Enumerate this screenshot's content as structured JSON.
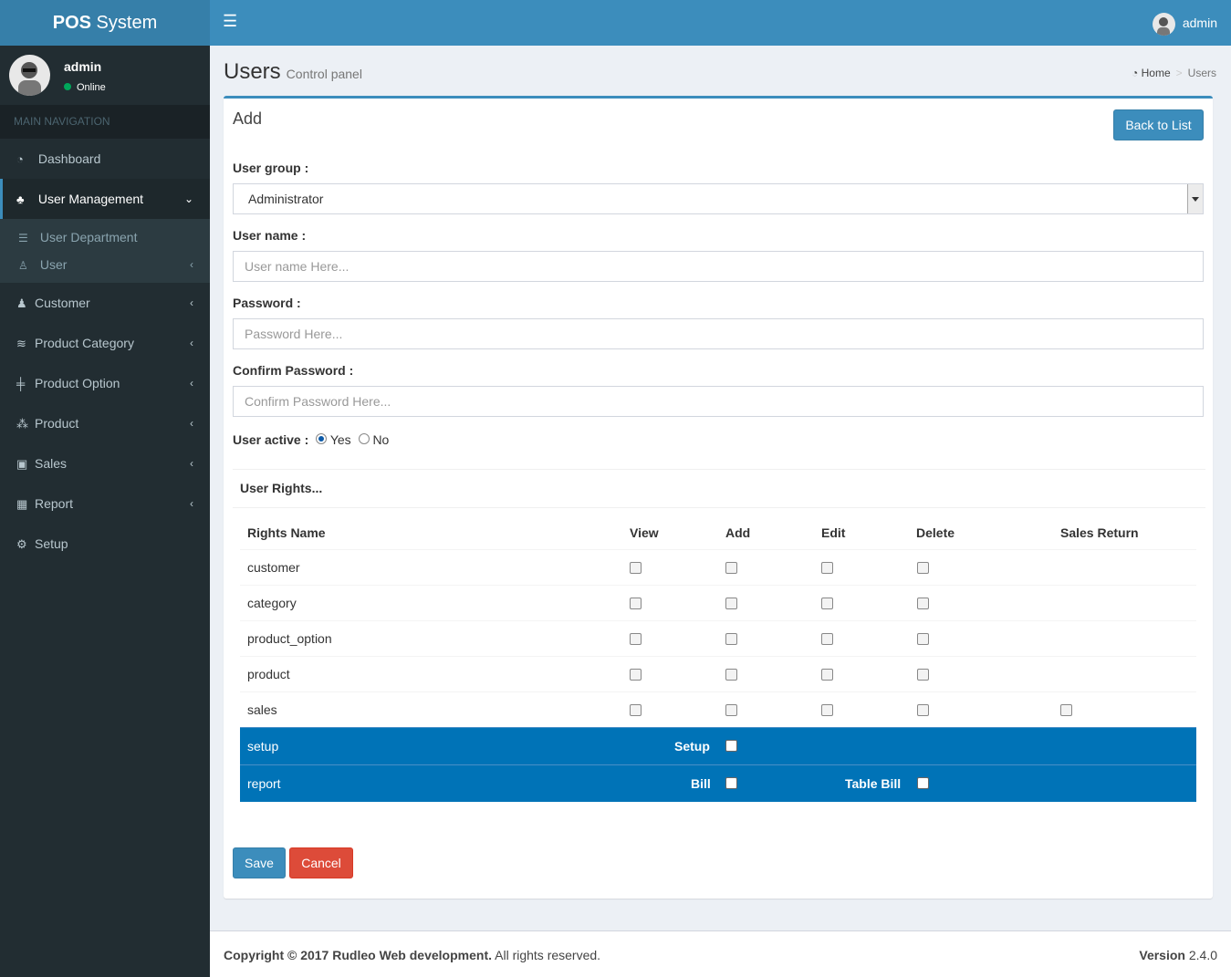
{
  "app": {
    "title_bold": "POS",
    "title_rest": " System"
  },
  "user": {
    "name": "admin",
    "status": "Online"
  },
  "nav": {
    "header": "MAIN NAVIGATION",
    "items": [
      {
        "label": "Dashboard",
        "icon": "dashboard-icon"
      },
      {
        "label": "User Management",
        "icon": "sitemap-icon"
      },
      {
        "label": "Customer",
        "icon": "user-icon"
      },
      {
        "label": "Product Category",
        "icon": "database-icon"
      },
      {
        "label": "Product Option",
        "icon": "signs-icon"
      },
      {
        "label": "Product",
        "icon": "cubes-icon"
      },
      {
        "label": "Sales",
        "icon": "calendar-check-icon"
      },
      {
        "label": "Report",
        "icon": "table-icon"
      },
      {
        "label": "Setup",
        "icon": "gear-icon"
      }
    ],
    "sub_items": [
      {
        "label": "User Department",
        "icon": "list-icon"
      },
      {
        "label": "User",
        "icon": "user-icon"
      }
    ]
  },
  "page": {
    "title": "Users",
    "subtitle": "Control panel"
  },
  "breadcrumb": {
    "home": "Home",
    "current": "Users"
  },
  "form": {
    "title": "Add",
    "back_label": "Back to List",
    "user_group_label": "User group :",
    "user_group_value": "Administrator",
    "username_label": "User name :",
    "username_placeholder": "User name Here...",
    "password_label": "Password :",
    "password_placeholder": "Password Here...",
    "confirm_label": "Confirm Password :",
    "confirm_placeholder": "Confirm Password Here...",
    "active_label": "User active :",
    "active_yes": "Yes",
    "active_no": "No",
    "rights_title": "User Rights...",
    "save_label": "Save",
    "cancel_label": "Cancel"
  },
  "rights": {
    "headers": {
      "name": "Rights Name",
      "view": "View",
      "add": "Add",
      "edit": "Edit",
      "delete": "Delete",
      "sales_return": "Sales Return"
    },
    "rows": [
      "customer",
      "category",
      "product_option",
      "product",
      "sales"
    ],
    "setup": {
      "name": "setup",
      "label": "Setup"
    },
    "report": {
      "name": "report",
      "bill_label": "Bill",
      "table_bill_label": "Table Bill"
    }
  },
  "footer": {
    "copyright": "Copyright © 2017 Rudleo Web development.",
    "rights": " All rights reserved.",
    "version_label": "Version",
    "version": " 2.4.0"
  },
  "colors": {
    "header": "#3c8dbc",
    "sidebar": "#222d32",
    "band": "#0073b7",
    "danger": "#dd4b39"
  }
}
